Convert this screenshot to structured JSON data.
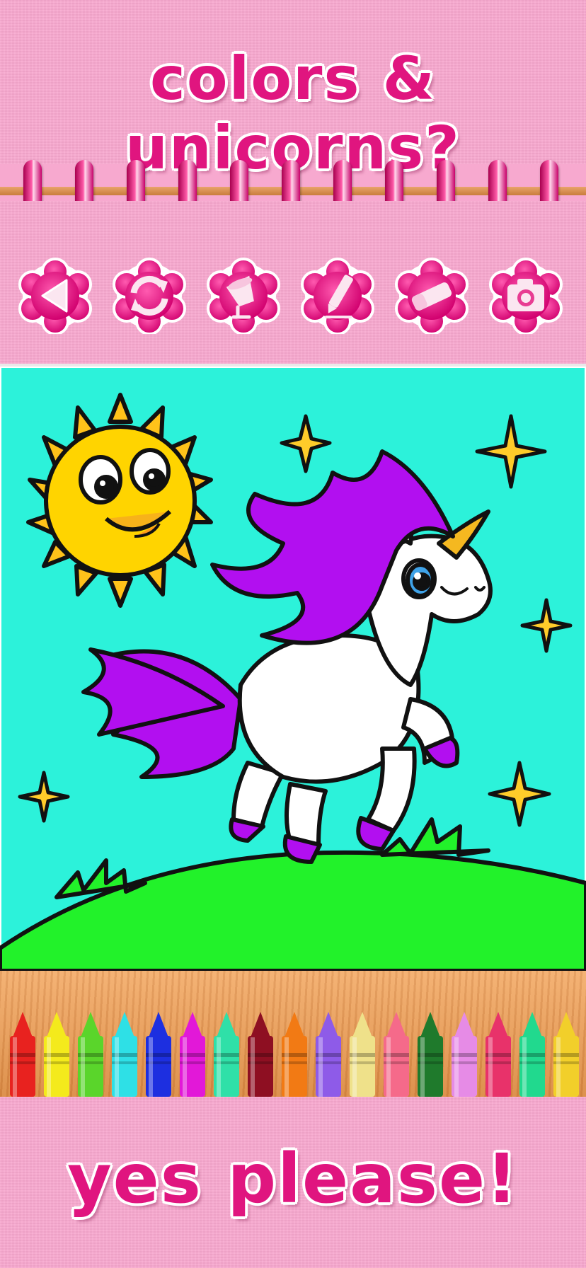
{
  "headline_top": "colors & unicorns?",
  "headline_bottom": "yes please!",
  "toolbar": {
    "tools": [
      {
        "name": "back",
        "icon": "back-arrow-icon"
      },
      {
        "name": "undo",
        "icon": "refresh-icon"
      },
      {
        "name": "fill",
        "icon": "paint-bucket-icon"
      },
      {
        "name": "marker",
        "icon": "marker-icon"
      },
      {
        "name": "eraser",
        "icon": "eraser-icon"
      },
      {
        "name": "camera",
        "icon": "camera-icon"
      }
    ]
  },
  "canvas": {
    "background": "#2cf2da",
    "sun_color": "#ffd400",
    "mane_color": "#b20ff0",
    "grass_color": "#22f22a",
    "star_color": "#ffcc2a"
  },
  "crayons": [
    "#e8221f",
    "#f4ea1c",
    "#5ad52b",
    "#2ee0e6",
    "#1d2fe0",
    "#e218d8",
    "#2fe0a8",
    "#8e0f22",
    "#f27a14",
    "#8e5be8",
    "#efe18a",
    "#f56a8a",
    "#1f7a2c",
    "#e68be6",
    "#e8326a",
    "#21d98e",
    "#f2cf2a"
  ]
}
